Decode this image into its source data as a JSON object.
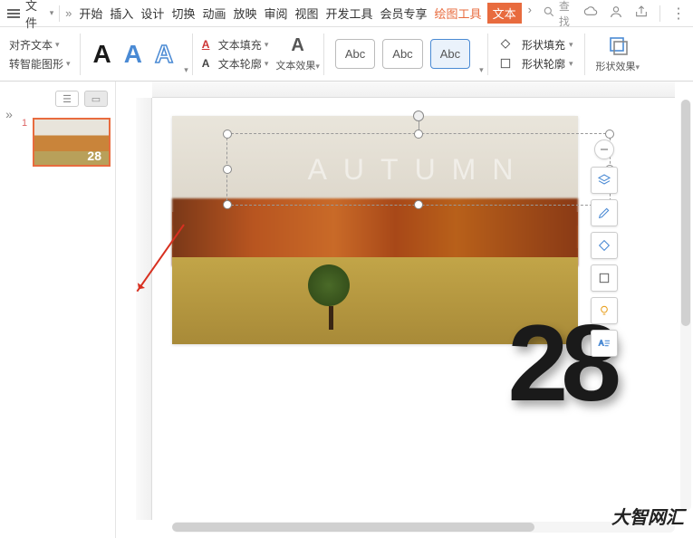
{
  "menu": {
    "file_label": "文件"
  },
  "tabs": {
    "start": "开始",
    "insert": "插入",
    "design": "设计",
    "transition": "切换",
    "animation": "动画",
    "slideshow": "放映",
    "review": "审阅",
    "view": "视图",
    "devtools": "开发工具",
    "vip": "会员专享",
    "drawing": "绘图工具",
    "text": "文本"
  },
  "search": {
    "placeholder": "查找"
  },
  "ribbon": {
    "align_text": "对齐文本",
    "smart_art": "转智能图形",
    "text_fill": "文本填充",
    "text_outline": "文本轮廓",
    "text_fx": "文本效果",
    "abc": "Abc",
    "shape_fill": "形状填充",
    "shape_outline": "形状轮廓",
    "shape_fx": "形状效果"
  },
  "thumbs": {
    "num": "1",
    "caption": "28"
  },
  "slide": {
    "selected_text": "AUTUMN",
    "number": "28"
  },
  "watermark": "大智网汇"
}
